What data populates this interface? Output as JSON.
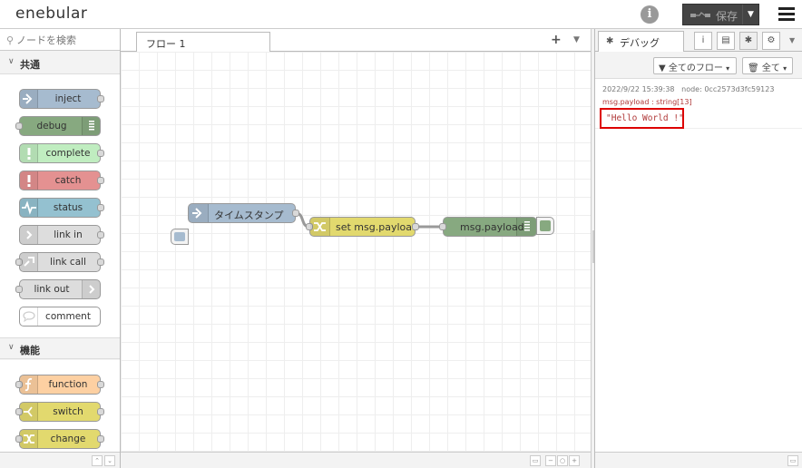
{
  "header": {
    "logo": "enebular",
    "deploy_label": "保存",
    "colors": {
      "deploy_bg": "#444444"
    }
  },
  "palette": {
    "search_placeholder": "ノードを検索",
    "categories": [
      {
        "label": "共通",
        "nodes": [
          {
            "label": "inject",
            "color": "#a6bbcf",
            "icon": "arrow-in-icon"
          },
          {
            "label": "debug",
            "color": "#87a980",
            "icon": "list-icon"
          },
          {
            "label": "complete",
            "color": "#c0edc0",
            "icon": "exclaim-icon"
          },
          {
            "label": "catch",
            "color": "#e49191",
            "icon": "exclaim-icon"
          },
          {
            "label": "status",
            "color": "#94c1d0",
            "icon": "pulse-icon"
          },
          {
            "label": "link in",
            "color": "#dddddd",
            "icon": "link-in-icon"
          },
          {
            "label": "link call",
            "color": "#dddddd",
            "icon": "link-call-icon"
          },
          {
            "label": "link out",
            "color": "#dddddd",
            "icon": "link-out-icon"
          },
          {
            "label": "comment",
            "color": "#ffffff",
            "icon": "comment-icon"
          }
        ]
      },
      {
        "label": "機能",
        "nodes": [
          {
            "label": "function",
            "color": "#fdd0a2",
            "icon": "function-icon"
          },
          {
            "label": "switch",
            "color": "#e2d96e",
            "icon": "switch-icon"
          },
          {
            "label": "change",
            "color": "#e2d96e",
            "icon": "shuffle-icon"
          }
        ]
      }
    ]
  },
  "workspace": {
    "tab_label": "フロー 1",
    "flow_nodes": [
      {
        "label": "タイムスタンプ",
        "type": "inject",
        "color": "#a6bbcf"
      },
      {
        "label": "set msg.payload",
        "type": "change",
        "color": "#e2d96e"
      },
      {
        "label": "msg.payload",
        "type": "debug",
        "color": "#87a980"
      }
    ]
  },
  "sidebar": {
    "tab_label": "デバッグ",
    "filter_flows": "全てのフロー",
    "filter_all": "全て",
    "message": {
      "timestamp": "2022/9/22 15:39:38",
      "node_label": "node: 0cc2573d3fc59123",
      "topic": "msg.payload : string[13]",
      "value": "\"Hello World !\""
    }
  }
}
